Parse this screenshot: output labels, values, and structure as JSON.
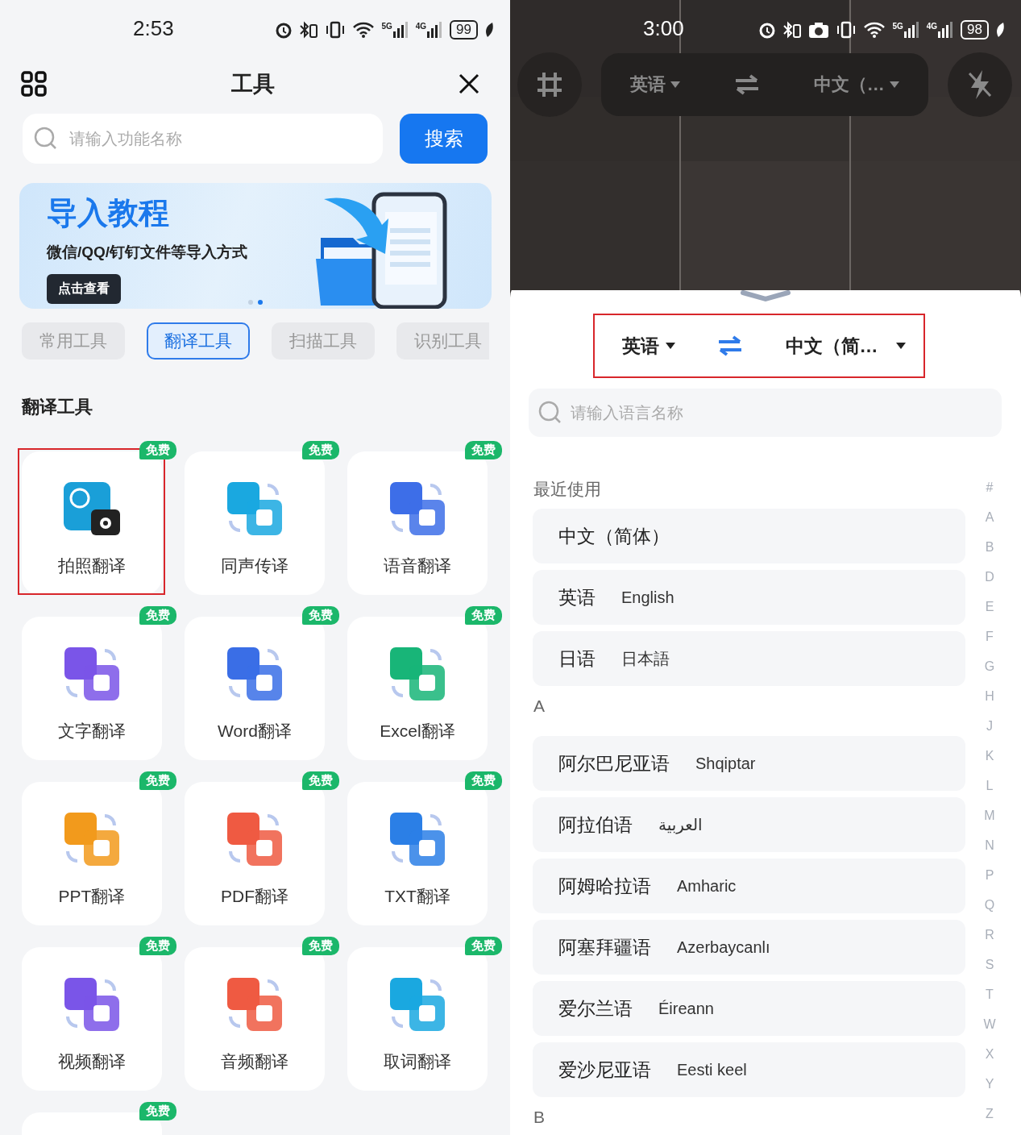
{
  "left": {
    "status": {
      "time": "2:53",
      "icons": [
        {
          "kind": "alarm"
        },
        {
          "kind": "bluetooth"
        },
        {
          "kind": "vibrate"
        },
        {
          "kind": "wifi"
        },
        {
          "kind": "signal",
          "label": "5G"
        },
        {
          "kind": "signal",
          "label": "4G"
        }
      ],
      "battery": "99"
    },
    "header": {
      "title": "工具"
    },
    "search": {
      "placeholder": "请输入功能名称",
      "button": "搜索"
    },
    "banner": {
      "title": "导入教程",
      "subtitle": "微信/QQ/钉钉文件等导入方式",
      "button": "点击查看",
      "dots": [
        {
          "selected": false
        },
        {
          "selected": true
        }
      ]
    },
    "tabs": [
      {
        "label": "常用工具",
        "selected": false
      },
      {
        "label": "翻译工具",
        "selected": true
      },
      {
        "label": "扫描工具",
        "selected": false
      },
      {
        "label": "识别工具",
        "selected": false
      }
    ],
    "section_title": "翻译工具",
    "tools": [
      {
        "label": "拍照翻译",
        "badge": "免费",
        "kind": "camera",
        "color": "#1a9fd8",
        "highlighted": true
      },
      {
        "label": "同声传译",
        "badge": "免费",
        "kind": "translate",
        "color": "#1aa8e0",
        "highlighted": false
      },
      {
        "label": "语音翻译",
        "badge": "免费",
        "kind": "translate",
        "color": "#3d6ee8",
        "highlighted": false
      },
      {
        "label": "文字翻译",
        "badge": "免费",
        "kind": "translate",
        "color": "#7a55e8",
        "highlighted": false
      },
      {
        "label": "Word翻译",
        "badge": "免费",
        "kind": "translate",
        "color": "#3a6ee6",
        "highlighted": false
      },
      {
        "label": "Excel翻译",
        "badge": "免费",
        "kind": "translate",
        "color": "#18b578",
        "highlighted": false
      },
      {
        "label": "PPT翻译",
        "badge": "免费",
        "kind": "translate",
        "color": "#f29a1c",
        "highlighted": false
      },
      {
        "label": "PDF翻译",
        "badge": "免费",
        "kind": "translate",
        "color": "#ef5a42",
        "highlighted": false
      },
      {
        "label": "TXT翻译",
        "badge": "免费",
        "kind": "translate",
        "color": "#2b7fe6",
        "highlighted": false
      },
      {
        "label": "视频翻译",
        "badge": "免费",
        "kind": "translate",
        "color": "#7a55e8",
        "highlighted": false
      },
      {
        "label": "音频翻译",
        "badge": "免费",
        "kind": "translate",
        "color": "#ef5a42",
        "highlighted": false
      },
      {
        "label": "取词翻译",
        "badge": "免费",
        "kind": "translate",
        "color": "#1aa8e0",
        "highlighted": false
      },
      {
        "badge": "免费",
        "highlighted": false
      }
    ]
  },
  "right": {
    "status": {
      "time": "3:00",
      "icons": [
        {
          "kind": "alarm"
        },
        {
          "kind": "bluetooth"
        },
        {
          "kind": "camera"
        },
        {
          "kind": "vibrate"
        },
        {
          "kind": "wifi"
        },
        {
          "kind": "signal",
          "label": "5G"
        },
        {
          "kind": "signal",
          "label": "4G"
        }
      ],
      "battery": "98"
    },
    "camera_bar": {
      "source": "英语",
      "target": "中文（…"
    },
    "sheet": {
      "source": "英语",
      "target": "中文（简…",
      "highlighted": true,
      "search_placeholder": "请输入语言名称",
      "groups": [
        {
          "title": "最近使用",
          "items": [
            {
              "name": "中文（简体）"
            },
            {
              "name": "英语",
              "native": "English"
            },
            {
              "name": "日语",
              "native": "日本語"
            }
          ]
        },
        {
          "title": "A",
          "items": [
            {
              "name": "阿尔巴尼亚语",
              "native": "Shqiptar"
            },
            {
              "name": "阿拉伯语",
              "native": "العربية"
            },
            {
              "name": "阿姆哈拉语",
              "native": "Amharic"
            },
            {
              "name": "阿塞拜疆语",
              "native": "Azerbaycanlı"
            },
            {
              "name": "爱尔兰语",
              "native": "Éireann"
            },
            {
              "name": "爱沙尼亚语",
              "native": "Eesti keel"
            }
          ]
        },
        {
          "title": "B"
        }
      ],
      "index": [
        "#",
        "A",
        "B",
        "D",
        "E",
        "F",
        "G",
        "H",
        "J",
        "K",
        "L",
        "M",
        "N",
        "P",
        "Q",
        "R",
        "S",
        "T",
        "W",
        "X",
        "Y",
        "Z"
      ]
    }
  }
}
